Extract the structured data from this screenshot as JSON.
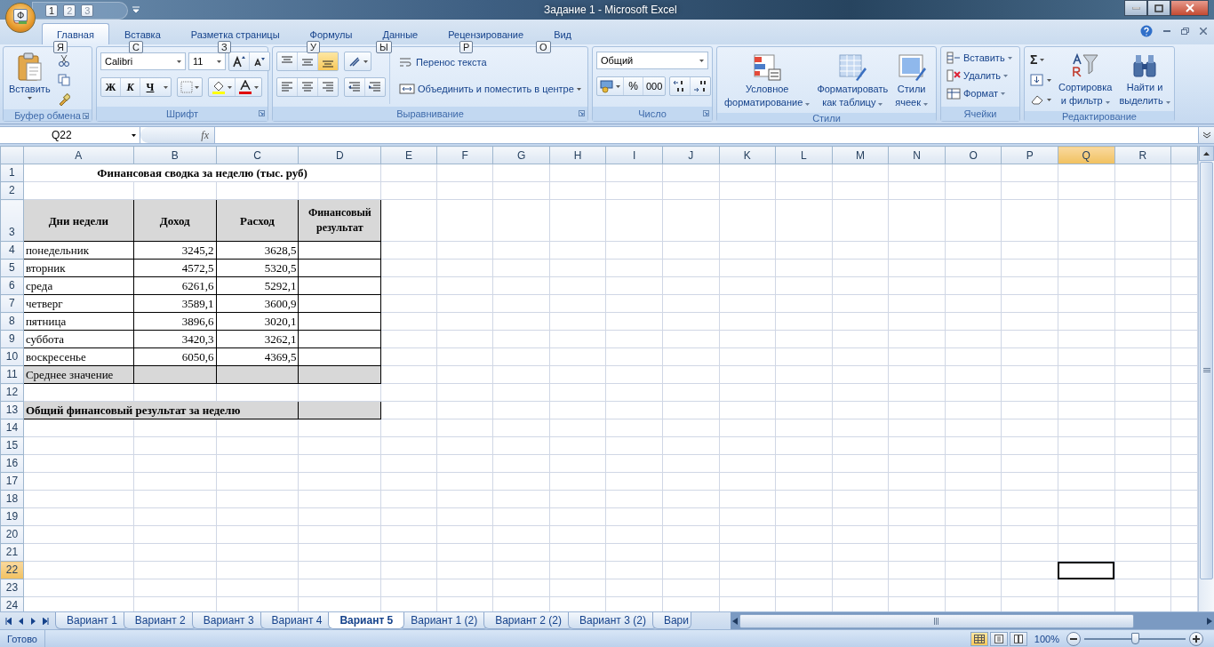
{
  "window": {
    "title": "Задание 1 - Microsoft Excel"
  },
  "office_button": {
    "keytip": "Ф"
  },
  "quick_access": [
    {
      "keytip": "1",
      "disabled": false
    },
    {
      "keytip": "2",
      "disabled": true
    },
    {
      "keytip": "3",
      "disabled": true
    }
  ],
  "tabs": [
    {
      "label": "Главная",
      "keytip": "Я",
      "selected": true
    },
    {
      "label": "Вставка",
      "keytip": "С",
      "selected": false
    },
    {
      "label": "Разметка страницы",
      "keytip": "З",
      "selected": false
    },
    {
      "label": "Формулы",
      "keytip": "У",
      "selected": false
    },
    {
      "label": "Данные",
      "keytip": "Ы",
      "selected": false
    },
    {
      "label": "Рецензирование",
      "keytip": "Р",
      "selected": false
    },
    {
      "label": "Вид",
      "keytip": "О",
      "selected": false
    }
  ],
  "ribbon": {
    "groups": [
      {
        "kind": "clipboard",
        "label": "Буфер обмена",
        "paste": "Вставить"
      },
      {
        "kind": "font",
        "label": "Шрифт",
        "font_name": "Calibri",
        "font_size": "11",
        "bold": "Ж",
        "italic": "К",
        "underline": "Ч"
      },
      {
        "kind": "alignment",
        "label": "Выравнивание",
        "wrap": "Перенос текста",
        "merge": "Объединить и поместить в центре"
      },
      {
        "kind": "number",
        "label": "Число",
        "format": "Общий",
        "percent": "%",
        "thousands": "000"
      },
      {
        "kind": "styles",
        "label": "Стили",
        "buttons": [
          {
            "lines": [
              "Условное",
              "форматирование"
            ]
          },
          {
            "lines": [
              "Форматировать",
              "как таблицу"
            ]
          },
          {
            "lines": [
              "Стили",
              "ячеек"
            ]
          }
        ]
      },
      {
        "kind": "cells",
        "label": "Ячейки",
        "buttons": [
          "Вставить",
          "Удалить",
          "Формат"
        ]
      },
      {
        "kind": "editing",
        "label": "Редактирование",
        "sum": "Σ",
        "buttons": [
          {
            "lines": [
              "Сортировка",
              "и фильтр"
            ]
          },
          {
            "lines": [
              "Найти и",
              "выделить"
            ]
          }
        ]
      }
    ]
  },
  "formula_bar": {
    "name_box": "Q22",
    "fx": "fx"
  },
  "columns": [
    {
      "label": "A",
      "selected": false
    },
    {
      "label": "B",
      "selected": false
    },
    {
      "label": "C",
      "selected": false
    },
    {
      "label": "D",
      "selected": false
    },
    {
      "label": "E",
      "selected": false
    },
    {
      "label": "F",
      "selected": false
    },
    {
      "label": "G",
      "selected": false
    },
    {
      "label": "H",
      "selected": false
    },
    {
      "label": "I",
      "selected": false
    },
    {
      "label": "J",
      "selected": false
    },
    {
      "label": "K",
      "selected": false
    },
    {
      "label": "L",
      "selected": false
    },
    {
      "label": "M",
      "selected": false
    },
    {
      "label": "N",
      "selected": false
    },
    {
      "label": "O",
      "selected": false
    },
    {
      "label": "P",
      "selected": false
    },
    {
      "label": "Q",
      "selected": true
    },
    {
      "label": "R",
      "selected": false
    }
  ],
  "rows": [
    {
      "number": "1",
      "kind": "title",
      "selected": false,
      "cells": [
        "Финансовая сводка за неделю (тыс. руб)"
      ]
    },
    {
      "number": "2",
      "kind": "empty",
      "selected": false
    },
    {
      "number": "3",
      "kind": "header",
      "selected": false,
      "cells": [
        "Дни недели",
        "Доход",
        "Расход",
        "Финансовый результат"
      ]
    },
    {
      "number": "4",
      "kind": "data",
      "selected": false,
      "cells": [
        "понедельник",
        "3245,2",
        "3628,5"
      ]
    },
    {
      "number": "5",
      "kind": "data",
      "selected": false,
      "cells": [
        "вторник",
        "4572,5",
        "5320,5"
      ]
    },
    {
      "number": "6",
      "kind": "data",
      "selected": false,
      "cells": [
        "среда",
        "6261,6",
        "5292,1"
      ]
    },
    {
      "number": "7",
      "kind": "data",
      "selected": false,
      "cells": [
        "четверг",
        "3589,1",
        "3600,9"
      ]
    },
    {
      "number": "8",
      "kind": "data",
      "selected": false,
      "cells": [
        "пятница",
        "3896,6",
        "3020,1"
      ]
    },
    {
      "number": "9",
      "kind": "data",
      "selected": false,
      "cells": [
        "суббота",
        "3420,3",
        "3262,1"
      ]
    },
    {
      "number": "10",
      "kind": "data",
      "selected": false,
      "cells": [
        "воскресенье",
        "6050,6",
        "4369,5"
      ]
    },
    {
      "number": "11",
      "kind": "average",
      "selected": false,
      "cells": [
        "Среднее значение"
      ]
    },
    {
      "number": "12",
      "kind": "empty",
      "selected": false
    },
    {
      "number": "13",
      "kind": "total",
      "selected": false,
      "cells": [
        "Общий финансовый результат за неделю"
      ]
    },
    {
      "number": "14",
      "kind": "empty",
      "selected": false
    },
    {
      "number": "15",
      "kind": "empty",
      "selected": false
    },
    {
      "number": "16",
      "kind": "empty",
      "selected": false
    },
    {
      "number": "17",
      "kind": "empty",
      "selected": false
    },
    {
      "number": "18",
      "kind": "empty",
      "selected": false
    },
    {
      "number": "19",
      "kind": "empty",
      "selected": false
    },
    {
      "number": "20",
      "kind": "empty",
      "selected": false
    },
    {
      "number": "21",
      "kind": "empty",
      "selected": false
    },
    {
      "number": "22",
      "kind": "empty",
      "selected": true
    },
    {
      "number": "23",
      "kind": "empty",
      "selected": false
    },
    {
      "number": "24",
      "kind": "empty",
      "selected": false
    }
  ],
  "sheet_tabs": [
    {
      "label": "Вариант 1",
      "selected": false
    },
    {
      "label": "Вариант 2",
      "selected": false
    },
    {
      "label": "Вариант 3",
      "selected": false
    },
    {
      "label": "Вариант 4",
      "selected": false
    },
    {
      "label": "Вариант 5",
      "selected": true
    },
    {
      "label": "Вариант 1 (2)",
      "selected": false
    },
    {
      "label": "Вариант 2 (2)",
      "selected": false
    },
    {
      "label": "Вариант 3 (2)",
      "selected": false
    },
    {
      "label": "Вари",
      "selected": false
    }
  ],
  "status_bar": {
    "status": "Готово",
    "zoom": "100%",
    "level": 0.5
  }
}
